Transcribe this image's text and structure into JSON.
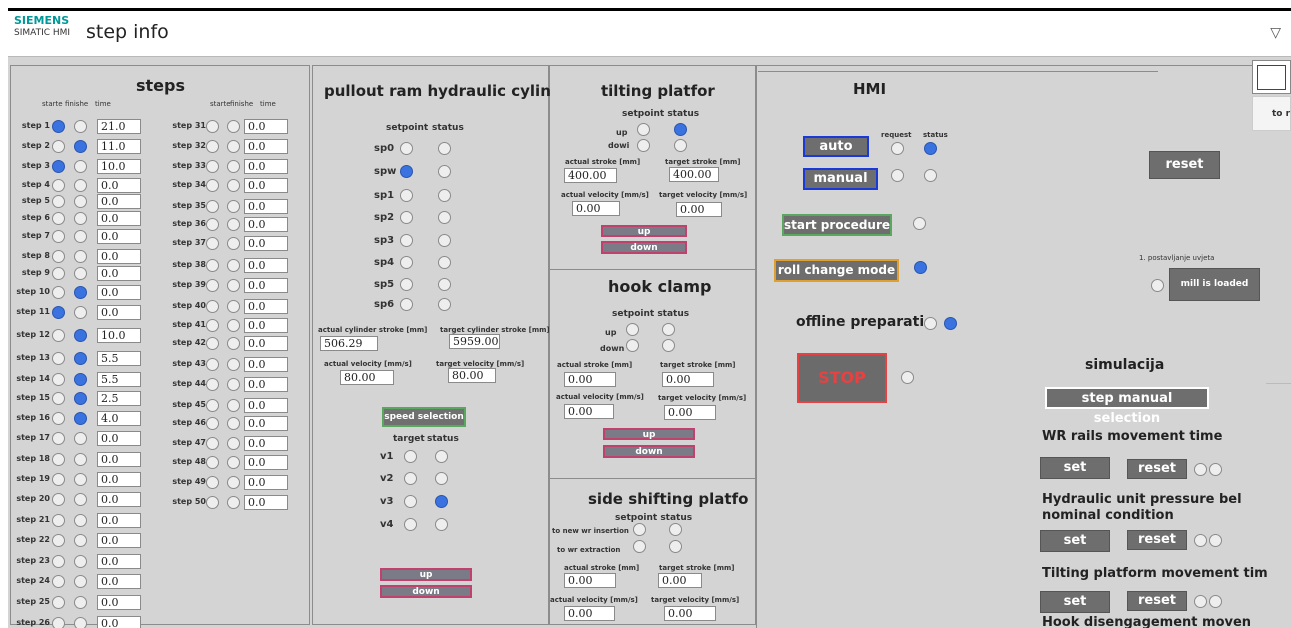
{
  "titlebar": {
    "brand": "SIEMENS",
    "product": "SIMATIC HMI",
    "screen": "step info",
    "menu": "▽"
  },
  "steps": {
    "title": "steps",
    "hdr": {
      "started": "starte",
      "finished": "finishe",
      "time": "time"
    },
    "col1": [
      {
        "label": "step 1",
        "s": true,
        "f": false,
        "time": "21.0"
      },
      {
        "label": "step 2",
        "s": false,
        "f": true,
        "time": "11.0"
      },
      {
        "label": "step 3",
        "s": true,
        "f": false,
        "time": "10.0"
      },
      {
        "label": "step 4",
        "s": false,
        "f": false,
        "time": "0.0"
      },
      {
        "label": "step 5",
        "s": false,
        "f": false,
        "time": "0.0"
      },
      {
        "label": "step 6",
        "s": false,
        "f": false,
        "time": "0.0"
      },
      {
        "label": "step 7",
        "s": false,
        "f": false,
        "time": "0.0"
      },
      {
        "label": "step 8",
        "s": false,
        "f": false,
        "time": "0.0"
      },
      {
        "label": "step 9",
        "s": false,
        "f": false,
        "time": "0.0"
      },
      {
        "label": "step 10",
        "s": false,
        "f": true,
        "time": "0.0"
      },
      {
        "label": "step 11",
        "s": true,
        "f": false,
        "time": "0.0"
      },
      {
        "label": "step 12",
        "s": false,
        "f": true,
        "time": "10.0"
      },
      {
        "label": "step 13",
        "s": false,
        "f": true,
        "time": "5.5"
      },
      {
        "label": "step 14",
        "s": false,
        "f": true,
        "time": "5.5"
      },
      {
        "label": "step 15",
        "s": false,
        "f": true,
        "time": "2.5"
      },
      {
        "label": "step 16",
        "s": false,
        "f": true,
        "time": "4.0"
      },
      {
        "label": "step 17",
        "s": false,
        "f": false,
        "time": "0.0"
      },
      {
        "label": "step 18",
        "s": false,
        "f": false,
        "time": "0.0"
      },
      {
        "label": "step 19",
        "s": false,
        "f": false,
        "time": "0.0"
      },
      {
        "label": "step 20",
        "s": false,
        "f": false,
        "time": "0.0"
      },
      {
        "label": "step 21",
        "s": false,
        "f": false,
        "time": "0.0"
      },
      {
        "label": "step 22",
        "s": false,
        "f": false,
        "time": "0.0"
      },
      {
        "label": "step 23",
        "s": false,
        "f": false,
        "time": "0.0"
      },
      {
        "label": "step 24",
        "s": false,
        "f": false,
        "time": "0.0"
      },
      {
        "label": "step 25",
        "s": false,
        "f": false,
        "time": "0.0"
      },
      {
        "label": "step 26",
        "s": false,
        "f": false,
        "time": "0.0"
      }
    ],
    "col2": [
      {
        "label": "step 31",
        "time": "0.0"
      },
      {
        "label": "step 32",
        "time": "0.0"
      },
      {
        "label": "step 33",
        "time": "0.0"
      },
      {
        "label": "step 34",
        "time": "0.0"
      },
      {
        "label": "step 35",
        "time": "0.0"
      },
      {
        "label": "step 36",
        "time": "0.0"
      },
      {
        "label": "step 37",
        "time": "0.0"
      },
      {
        "label": "step 38",
        "time": "0.0"
      },
      {
        "label": "step 39",
        "time": "0.0"
      },
      {
        "label": "step 40",
        "time": "0.0"
      },
      {
        "label": "step 41",
        "time": "0.0"
      },
      {
        "label": "step 42",
        "time": "0.0"
      },
      {
        "label": "step 43",
        "time": "0.0"
      },
      {
        "label": "step 44",
        "time": "0.0"
      },
      {
        "label": "step 45",
        "time": "0.0"
      },
      {
        "label": "step 46",
        "time": "0.0"
      },
      {
        "label": "step 47",
        "time": "0.0"
      },
      {
        "label": "step 48",
        "time": "0.0"
      },
      {
        "label": "step 49",
        "time": "0.0"
      },
      {
        "label": "step 50",
        "time": "0.0"
      }
    ]
  },
  "pullout": {
    "title": "pullout ram hydraulic cylin",
    "setpoint": "setpoint",
    "status": "status",
    "rows": [
      {
        "label": "sp0",
        "sp": false,
        "st": false
      },
      {
        "label": "spw",
        "sp": true,
        "st": false
      },
      {
        "label": "sp1",
        "sp": false,
        "st": false
      },
      {
        "label": "sp2",
        "sp": false,
        "st": false
      },
      {
        "label": "sp3",
        "sp": false,
        "st": false
      },
      {
        "label": "sp4",
        "sp": false,
        "st": false
      },
      {
        "label": "sp5",
        "sp": false,
        "st": false
      },
      {
        "label": "sp6",
        "sp": false,
        "st": false
      }
    ],
    "actual_stroke_label": "actual cylinder stroke [mm]",
    "actual_stroke": "506.29",
    "target_stroke_label": "target cylinder stroke [mm]",
    "target_stroke": "5959.00",
    "actual_vel_label": "actual velocity [mm/s]",
    "actual_vel": "80.00",
    "target_vel_label": "target velocity [mm/s]",
    "target_vel": "80.00",
    "speed_selection": "speed selection",
    "target": "target",
    "v_rows": [
      {
        "label": "v1",
        "t": false,
        "st": false
      },
      {
        "label": "v2",
        "t": false,
        "st": false
      },
      {
        "label": "v3",
        "t": false,
        "st": true
      },
      {
        "label": "v4",
        "t": false,
        "st": false
      }
    ],
    "up": "up",
    "down": "down"
  },
  "tilting": {
    "title": "tilting platfor",
    "setpoint_status": "setpoint status",
    "up": "up",
    "down_lbl": "dowi",
    "actual_stroke_label": "actual stroke [mm]",
    "actual_stroke": "400.00",
    "target_stroke_label": "target stroke [mm]",
    "target_stroke": "400.00",
    "actual_vel_label": "actual velocity [mm/s]",
    "actual_vel": "0.00",
    "target_vel_label": "target velocity [mm/s]",
    "target_vel": "0.00",
    "btn_up": "up",
    "btn_down": "down"
  },
  "hook": {
    "title": "hook clamp",
    "setpoint_status": "setpoint status",
    "up": "up",
    "down_lbl": "down",
    "actual_stroke_label": "actual stroke [mm]",
    "actual_stroke": "0.00",
    "target_stroke_label": "target stroke [mm]",
    "target_stroke": "0.00",
    "actual_vel_label": "actual velocity [mm/s]",
    "actual_vel": "0.00",
    "target_vel_label": "target velocity [mm/s]",
    "target_vel": "0.00",
    "btn_up": "up",
    "btn_down": "down"
  },
  "side": {
    "title": "side shifting platfor",
    "setpoint_status": "setpoint status",
    "new_wr": "to new wr insertion",
    "wr_ext": "to wr extraction",
    "actual_stroke_label": "actual stroke [mm]",
    "actual_stroke": "0.00",
    "target_stroke_label": "target stroke [mm]",
    "target_stroke": "0.00",
    "actual_vel_label": "actual velocity [mm/s]",
    "actual_vel": "0.00",
    "target_vel_label": "target velocity [mm/s]",
    "target_vel": "0.00"
  },
  "hmi": {
    "title": "HMI",
    "request": "request",
    "status": "status",
    "auto": "auto",
    "manual": "manual",
    "start_procedure": "start procedure",
    "roll_change": "roll change mode",
    "offline": "offline preparatio",
    "stop": "STOP",
    "reset": "reset",
    "condition_label": "1. postavljanje uvjeta",
    "mill_loaded": "mill is loaded",
    "simulacija": "simulacija",
    "step_manual": "step manual selection",
    "wr_rails": "WR rails movement time",
    "hyd_unit": "Hydraulic unit pressure bel nominal condition",
    "tilting_time": "Tilting platform movement tim",
    "hook_dis": "Hook disengagement moven",
    "set": "set",
    "reset_small": "reset",
    "top_right_btn": "to r"
  },
  "colors": {
    "active_radio": "#3a73e0",
    "panel_bg": "#d4d4d4",
    "button_border_pink": "#c0416b",
    "green_border": "#5aa860",
    "orange_border": "#e0a030",
    "stop_red": "#e84141"
  }
}
